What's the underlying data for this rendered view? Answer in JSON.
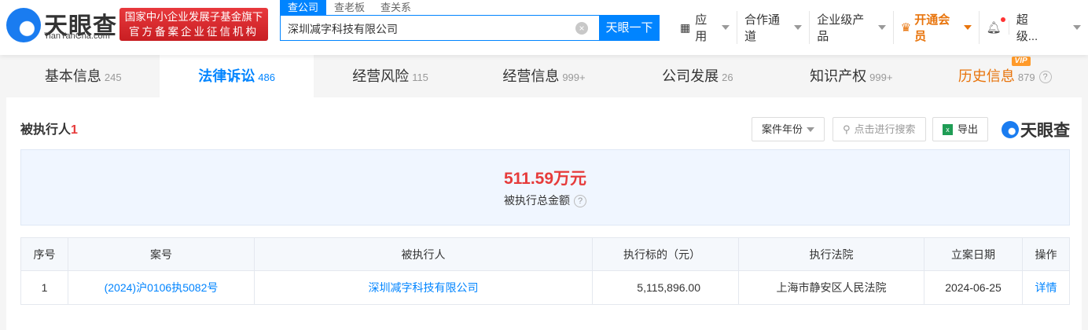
{
  "header": {
    "logo": "天眼查",
    "logo_sub": "TianYanCha.com",
    "banner_line1": "国家中小企业发展子基金旗下",
    "banner_line2": "官方备案企业征信机构",
    "search_tabs": [
      "查公司",
      "查老板",
      "查关系"
    ],
    "search_value": "深圳减字科技有限公司",
    "search_button": "天眼一下",
    "nav": [
      "应用",
      "合作通道",
      "企业级产品",
      "开通会员",
      "超级..."
    ]
  },
  "tabs": [
    {
      "label": "基本信息",
      "count": "245"
    },
    {
      "label": "法律诉讼",
      "count": "486"
    },
    {
      "label": "经营风险",
      "count": "115"
    },
    {
      "label": "经营信息",
      "count": "999+"
    },
    {
      "label": "公司发展",
      "count": "26"
    },
    {
      "label": "知识产权",
      "count": "999+"
    },
    {
      "label": "历史信息",
      "count": "879",
      "badge": "VIP"
    }
  ],
  "section": {
    "title": "被执行人",
    "count": "1",
    "filter": "案件年份",
    "search_placeholder": "点击进行搜索",
    "export": "导出",
    "brand": "天眼查"
  },
  "summary": {
    "amount": "511.59万元",
    "label": "被执行总金额"
  },
  "table": {
    "headers": [
      "序号",
      "案号",
      "被执行人",
      "执行标的（元）",
      "执行法院",
      "立案日期",
      "操作"
    ],
    "rows": [
      [
        "1",
        "(2024)沪0106执5082号",
        "深圳减字科技有限公司",
        "5,115,896.00",
        "上海市静安区人民法院",
        "2024-06-25",
        "详情"
      ]
    ]
  },
  "colors": {
    "accent": "#0084ff",
    "red": "#e63b3b",
    "vip": "#e8740c"
  }
}
